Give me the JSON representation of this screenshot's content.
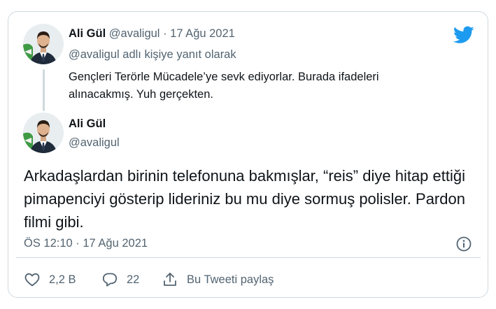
{
  "parent_tweet": {
    "author_name": "Ali Gül",
    "handle": "@avaligul",
    "separator": "·",
    "date": "17 Ağu 2021",
    "reply_context": "@avaligul adlı kişiye yanıt olarak",
    "text": "Gençleri Terörle Mücadele’ye sevk ediyorlar. Burada ifadeleri alınacakmış. Yuh gerçekten."
  },
  "main_tweet": {
    "author_name": "Ali Gül",
    "handle": "@avaligul",
    "text": "Arkadaşlardan birinin telefonuna bakmışlar, “reis” diye hitap ettiği pimapenciyi gösterip lideriniz bu mu diye sormuş polisler. Pardon filmi gibi.",
    "timestamp": "ÖS 12:10 · 17 Ağu 2021"
  },
  "actions": {
    "likes": "2,2 B",
    "replies": "22",
    "share_label": "Bu Tweeti paylaş"
  },
  "icons": {
    "brand": "twitter-bird-icon",
    "info": "info-icon",
    "like": "heart-icon",
    "reply": "speech-bubble-icon",
    "share": "share-upload-icon"
  },
  "colors": {
    "twitter_blue": "#1d9bf0",
    "text_primary": "#0f1419",
    "text_secondary": "#536471",
    "border": "#cfd9de"
  }
}
